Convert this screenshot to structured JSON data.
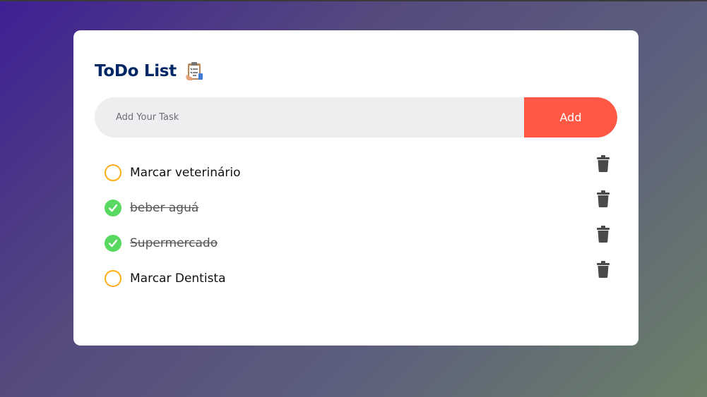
{
  "app": {
    "title": "ToDo List"
  },
  "input": {
    "placeholder": "Add Your Task",
    "value": ""
  },
  "add_button": {
    "label": "Add"
  },
  "tasks": [
    {
      "label": "Marcar veterinário",
      "done": false
    },
    {
      "label": "beber aguá",
      "done": true
    },
    {
      "label": "Supermercado",
      "done": true
    },
    {
      "label": "Marcar Dentista",
      "done": false
    }
  ],
  "colors": {
    "title": "#002765",
    "accent": "#ff5945",
    "checked": "#58d95f",
    "unchecked": "#ffac17",
    "trash": "#4a4a4a"
  },
  "icons": {
    "title_icon": "clipboard-checklist-icon",
    "check": "check-icon",
    "delete": "trash-icon"
  }
}
